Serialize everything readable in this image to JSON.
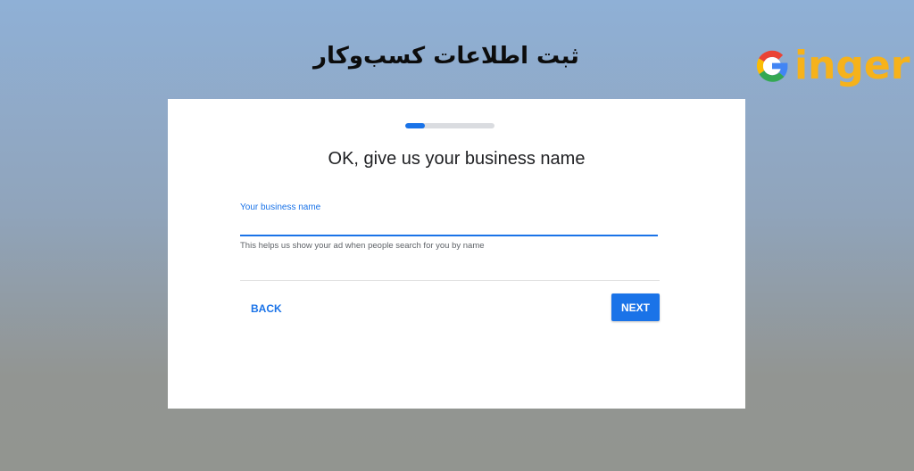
{
  "banner": {
    "title": "ثبت اطلاعات کسب‌وکار"
  },
  "logo": {
    "text": "inger",
    "icon": "google-g-icon",
    "colors": {
      "text": "#f6b21b",
      "red": "#ea4335",
      "yellow": "#fbbc05",
      "green": "#34a853",
      "blue": "#4285f4"
    }
  },
  "form": {
    "progress_fraction": 0.22,
    "heading": "OK, give us your business name",
    "field_label": "Your business name",
    "field_value": "",
    "helper_text": "This helps us show your ad when people search for you by name",
    "back_label": "BACK",
    "next_label": "NEXT"
  },
  "colors": {
    "accent": "#1a73e8",
    "bg_top": "#8fb0d6",
    "bg_bottom": "#929590"
  }
}
